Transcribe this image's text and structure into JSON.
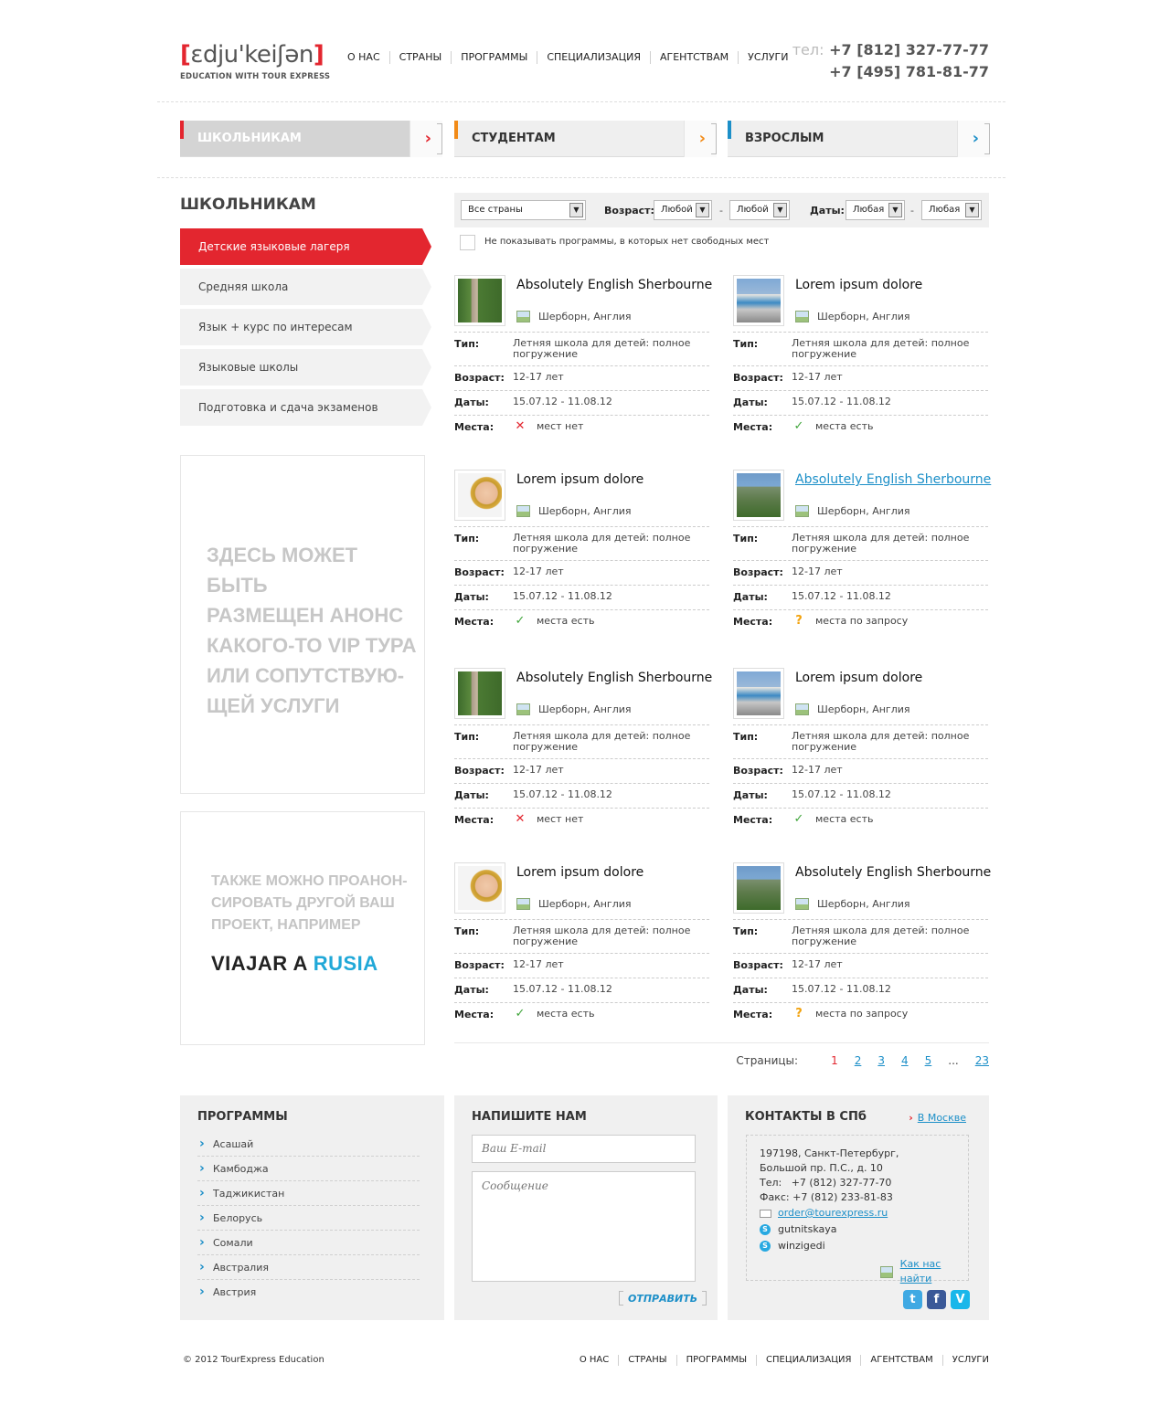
{
  "header": {
    "logo_text": "ɛdju'keiʃən",
    "logo_bracket_left": "[",
    "logo_bracket_right": "]",
    "logo_sub": "EDUCATION WITH TOUR EXPRESS",
    "nav": [
      "О НАС",
      "СТРАНЫ",
      "ПРОГРАММЫ",
      "СПЕЦИАЛИЗАЦИЯ",
      "АГЕНТСТВАМ",
      "УСЛУГИ"
    ],
    "phone_label": "тел:",
    "phone1": "+7 [812] 327-77-77",
    "phone2": "+7 [495] 781-81-77"
  },
  "audience_tabs": [
    {
      "label": "ШКОЛЬНИКАМ",
      "color": "#e3262f",
      "arrow": "›"
    },
    {
      "label": "СТУДЕНТАМ",
      "color": "#f28b18",
      "arrow": "›"
    },
    {
      "label": "ВЗРОСЛЫМ",
      "color": "#1c8fc8",
      "arrow": "›"
    }
  ],
  "sidebar": {
    "title": "ШКОЛЬНИКАМ",
    "items": [
      "Детские языковые лагеря",
      "Средняя школа",
      "Язык + курс по интересам",
      "Языковые школы",
      "Подготовка и сдача экзаменов"
    ],
    "promo1_lines": [
      "ЗДЕСЬ МОЖЕТ БЫТЬ",
      "РАЗМЕЩЕН АНОНС",
      "КАКОГО-ТО VIP ТУРА",
      "ИЛИ СОПУТСТВУЮ-",
      "ЩЕЙ УСЛУГИ"
    ],
    "promo2_lines": [
      "ТАКЖЕ МОЖНО ПРОАНОН-",
      "СИРОВАТЬ ДРУГОЙ ВАШ",
      "ПРОЕКТ, НАПРИМЕР"
    ],
    "promo2_brand_a": "VIAJAR A",
    "promo2_brand_b": "RUSIA"
  },
  "filter": {
    "country": "Все страны",
    "age_label": "Возраст:",
    "age_from": "Любой",
    "age_to": "Любой",
    "dates_label": "Даты:",
    "date_from": "Любая",
    "date_to": "Любая",
    "dash": "-",
    "checkbox_label": "Не показывать программы, в которых нет свободных мест"
  },
  "labels": {
    "type": "Тип:",
    "age": "Возраст:",
    "dates": "Даты:",
    "places": "Места:"
  },
  "cards": [
    {
      "title": "Absolutely English Sherbourne",
      "loc": "Шерборн, Англия",
      "type": "Летняя школа для детей: полное погружение",
      "age": "12-17 лет",
      "dates": "15.07.12 - 11.08.12",
      "status": "мест нет",
      "status_kind": "no",
      "image": "ivy-building-icon"
    },
    {
      "title": "Lorem ipsum dolore",
      "loc": "Шерборн, Англия",
      "type": "Летняя школа для детей: полное погружение",
      "age": "12-17 лет",
      "dates": "15.07.12 - 11.08.12",
      "status": "места есть",
      "status_kind": "yes",
      "image": "group-photo-icon"
    },
    {
      "title": "Lorem ipsum dolore",
      "loc": "Шерборн, Англия",
      "type": "Летняя школа для детей: полное погружение",
      "age": "12-17 лет",
      "dates": "15.07.12 - 11.08.12",
      "status": "места есть",
      "status_kind": "yes",
      "image": "kids-photo-icon"
    },
    {
      "title": "Absolutely English Sherbourne",
      "loc": "Шерборн, Англия",
      "type": "Летняя школа для детей: полное погружение",
      "age": "12-17 лет",
      "dates": "15.07.12 - 11.08.12",
      "status": "места по запросу",
      "status_kind": "q",
      "image": "building-photo-icon"
    },
    {
      "title": "Absolutely English Sherbourne",
      "loc": "Шерборн, Англия",
      "type": "Летняя школа для детей: полное погружение",
      "age": "12-17 лет",
      "dates": "15.07.12 - 11.08.12",
      "status": "мест нет",
      "status_kind": "no",
      "image": "ivy-building-icon"
    },
    {
      "title": "Lorem ipsum dolore",
      "loc": "Шерборн, Англия",
      "type": "Летняя школа для детей: полное погружение",
      "age": "12-17 лет",
      "dates": "15.07.12 - 11.08.12",
      "status": "места есть",
      "status_kind": "yes",
      "image": "group-photo-icon"
    },
    {
      "title": "Lorem ipsum dolore",
      "loc": "Шерборн, Англия",
      "type": "Летняя школа для детей: полное погружение",
      "age": "12-17 лет",
      "dates": "15.07.12 - 11.08.12",
      "status": "места есть",
      "status_kind": "yes",
      "image": "kids-photo-icon"
    },
    {
      "title": "Absolutely English Sherbourne",
      "loc": "Шерборн, Англия",
      "type": "Летняя школа для детей: полное погружение",
      "age": "12-17 лет",
      "dates": "15.07.12 - 11.08.12",
      "status": "места по запросу",
      "status_kind": "q",
      "image": "building-photo-icon"
    }
  ],
  "pager": {
    "label": "Страницы:",
    "pages": [
      "1",
      "2",
      "3",
      "4",
      "5"
    ],
    "ellipsis": "...",
    "last": "23",
    "current": "1"
  },
  "footer_programs": {
    "title": "ПРОГРАММЫ",
    "items": [
      "Асашай",
      "Камбоджа",
      "Таджикистан",
      "Белорусь",
      "Сомали",
      "Австралия",
      "Австрия"
    ]
  },
  "footer_write": {
    "title": "НАПИШИТЕ НАМ",
    "email_placeholder": "Ваш E-mail",
    "message_placeholder": "Сообщение",
    "send_label": "ОТПРАВИТЬ"
  },
  "footer_contacts": {
    "title": "КОНТАКТЫ В СПб",
    "moscow_link": "В Москве",
    "addr1": "197198, Санкт-Петербург,",
    "addr2": "Большой пр. П.С., д. 10",
    "tel": "Тел:   +7 (812) 327-77-70",
    "fax": "Факс: +7 (812) 233-81-83",
    "email": "order@tourexpress.ru",
    "skype1": "gutnitskaya",
    "skype2": "winzigedi",
    "find_link": "Как нас найти",
    "social": [
      {
        "name": "twitter-icon",
        "glyph": "t",
        "color": "#3fa9e3"
      },
      {
        "name": "facebook-icon",
        "glyph": "f",
        "color": "#3b5998"
      },
      {
        "name": "vimeo-icon",
        "glyph": "V",
        "color": "#1ab7ea"
      }
    ]
  },
  "bottom": {
    "copyright": "© 2012 TourExpress Education",
    "nav": [
      "О НАС",
      "СТРАНЫ",
      "ПРОГРАММЫ",
      "СПЕЦИАЛИЗАЦИЯ",
      "АГЕНТСТВАМ",
      "УСЛУГИ"
    ]
  },
  "colors": {
    "accent_red": "#e3262f",
    "accent_orange": "#f28b18",
    "accent_blue": "#1c8fc8",
    "status_yes": "#3fa53a",
    "status_q": "#f2a20d"
  }
}
